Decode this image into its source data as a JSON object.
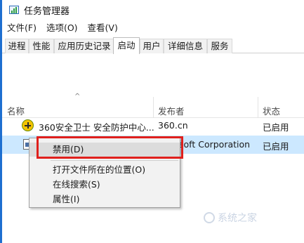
{
  "window": {
    "title": "任务管理器"
  },
  "menubar": [
    {
      "label": "文件(F)"
    },
    {
      "label": "选项(O)"
    },
    {
      "label": "查看(V)"
    }
  ],
  "tabs": [
    {
      "label": "进程"
    },
    {
      "label": "性能"
    },
    {
      "label": "应用历史记录"
    },
    {
      "label": "启动",
      "active": true
    },
    {
      "label": "用户"
    },
    {
      "label": "详细信息"
    },
    {
      "label": "服务"
    }
  ],
  "table": {
    "sort_caret": "^",
    "columns": [
      "名称",
      "发布者",
      "状态"
    ],
    "rows": [
      {
        "icon": "360-safe-icon",
        "name": "360安全卫士 安全防护中心...",
        "publisher": "360.cn",
        "status": "已启用"
      },
      {
        "icon": "document-icon",
        "name": "",
        "publisher": "soft Corporation",
        "status": "已启用",
        "selected": true
      }
    ]
  },
  "context_menu": {
    "items": [
      {
        "label": "禁用(D)",
        "highlighted": true
      },
      {
        "label": "打开文件所在的位置(O)"
      },
      {
        "label": "在线搜索(S)"
      },
      {
        "label": "属性(I)"
      }
    ]
  },
  "watermark": {
    "text": "系统之家"
  },
  "colors": {
    "accent": "#1e6fd0",
    "selected_row": "#cce8ff",
    "highlight_box": "#e0201c"
  }
}
